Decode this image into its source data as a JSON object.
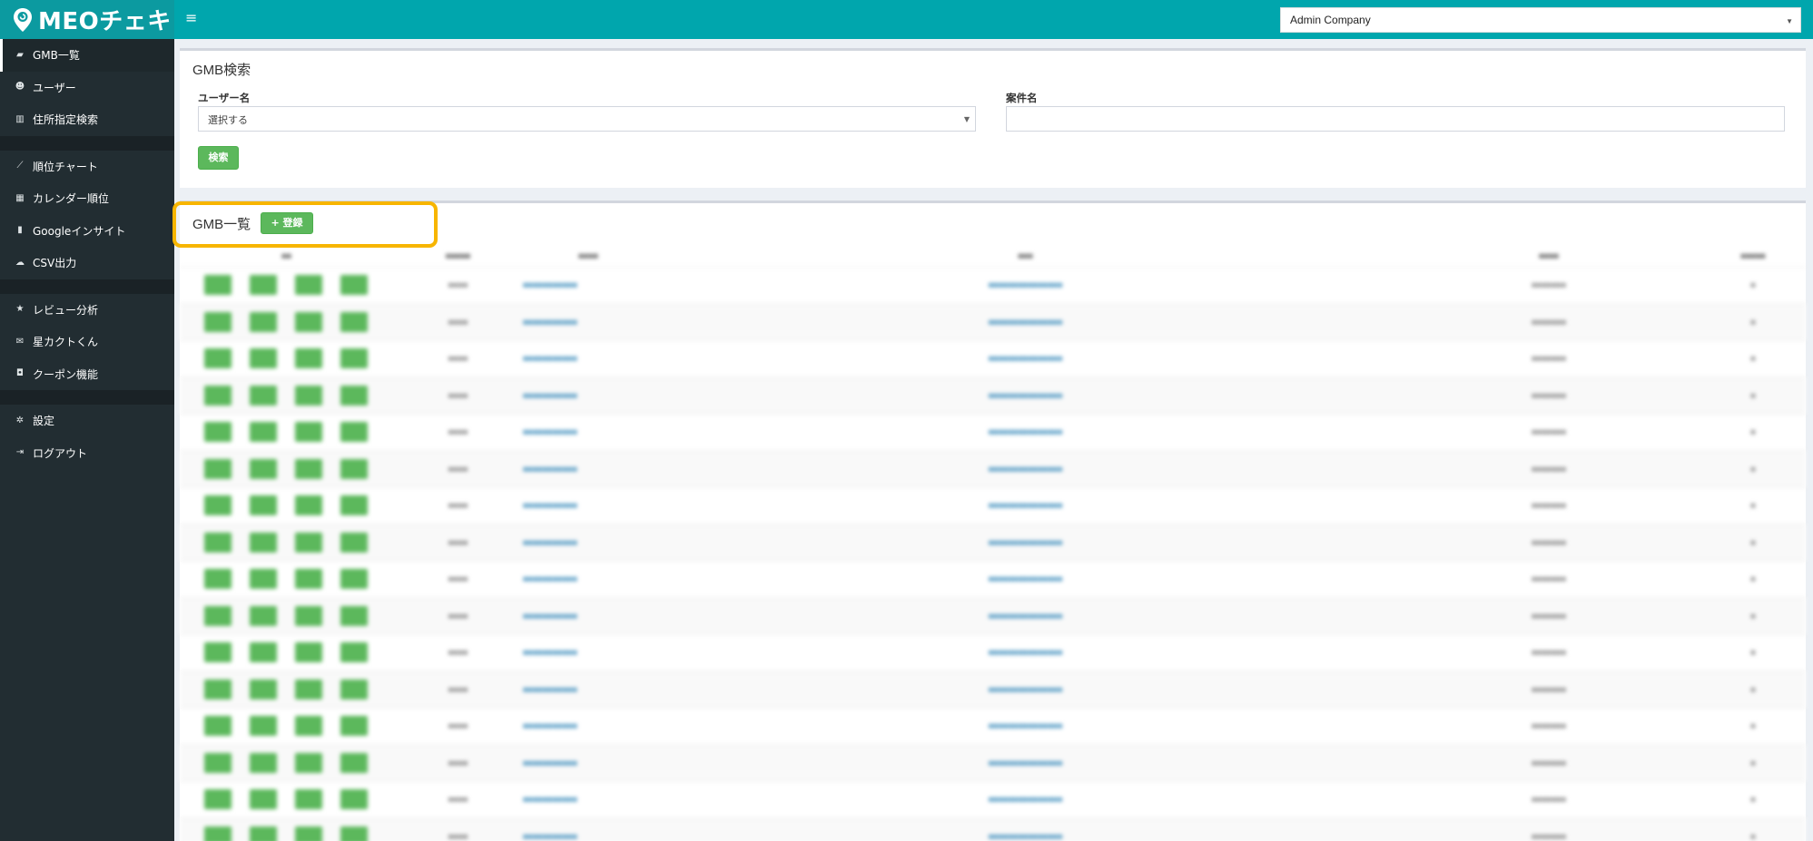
{
  "app": {
    "logo_text": "MEOチェキ",
    "company_selected": "Admin Company"
  },
  "sidebar": {
    "groups": [
      [
        {
          "label": "GMB一覧",
          "icon": "briefcase-icon",
          "active": true
        },
        {
          "label": "ユーザー",
          "icon": "users-icon"
        },
        {
          "label": "住所指定検索",
          "icon": "map-icon"
        }
      ],
      [
        {
          "label": "順位チャート",
          "icon": "line-chart-icon"
        },
        {
          "label": "カレンダー順位",
          "icon": "calendar-icon"
        },
        {
          "label": "Googleインサイト",
          "icon": "bar-chart-icon"
        },
        {
          "label": "CSV出力",
          "icon": "cloud-download-icon"
        }
      ],
      [
        {
          "label": "レビュー分析",
          "icon": "star-icon"
        },
        {
          "label": "星カクトくん",
          "icon": "envelope-icon"
        },
        {
          "label": "クーポン機能",
          "icon": "gift-icon"
        }
      ],
      [
        {
          "label": "設定",
          "icon": "gear-icon"
        },
        {
          "label": "ログアウト",
          "icon": "sign-out-icon"
        }
      ]
    ]
  },
  "search": {
    "title": "GMB検索",
    "user_label": "ユーザー名",
    "user_value": "選択する",
    "project_label": "案件名",
    "project_value": "",
    "search_button": "検索"
  },
  "list": {
    "title": "GMB一覧",
    "register_button": "+ 登録",
    "row_count": 16
  },
  "colors": {
    "header": "#00a6ad",
    "logo_bg": "#0c9aa0",
    "sidebar": "#222d32",
    "green_button": "#5cb85c",
    "highlight": "#f7b500"
  }
}
